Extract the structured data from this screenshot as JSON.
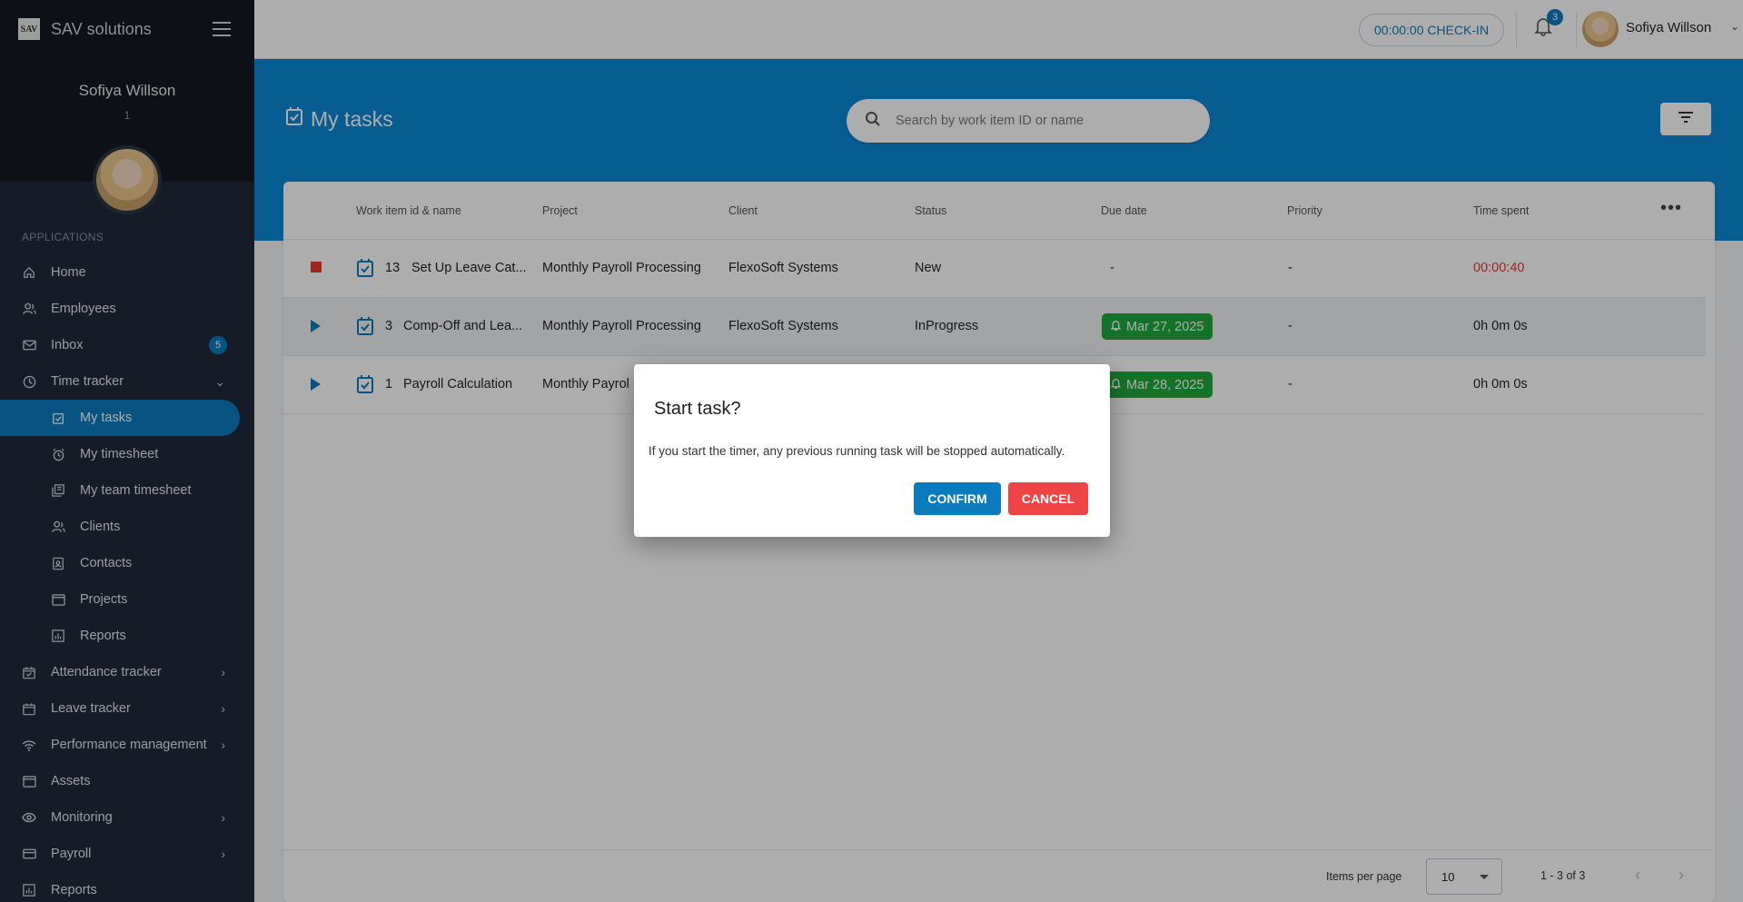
{
  "brand": {
    "logo_text": "SAV",
    "name": "SAV solutions"
  },
  "sidebar": {
    "user_name": "Sofiya Willson",
    "user_id": "1",
    "apps_label": "APPLICATIONS",
    "items": [
      {
        "label": "Home",
        "icon": "home-icon"
      },
      {
        "label": "Employees",
        "icon": "people-icon"
      },
      {
        "label": "Inbox",
        "icon": "mail-icon",
        "badge": "5"
      },
      {
        "label": "Time tracker",
        "icon": "clock-icon",
        "expanded": true
      },
      {
        "label": "My tasks",
        "icon": "task-check-icon",
        "active": true
      },
      {
        "label": "My timesheet",
        "icon": "alarm-icon"
      },
      {
        "label": "My team timesheet",
        "icon": "library-icon"
      },
      {
        "label": "Clients",
        "icon": "people-icon"
      },
      {
        "label": "Contacts",
        "icon": "contact-card-icon"
      },
      {
        "label": "Projects",
        "icon": "window-icon"
      },
      {
        "label": "Reports",
        "icon": "chart-icon"
      },
      {
        "label": "Attendance tracker",
        "icon": "calendar-check-icon"
      },
      {
        "label": "Leave tracker",
        "icon": "calendar-icon"
      },
      {
        "label": "Performance management",
        "icon": "wifi-icon"
      },
      {
        "label": "Assets",
        "icon": "window-icon"
      },
      {
        "label": "Monitoring",
        "icon": "eye-icon"
      },
      {
        "label": "Payroll",
        "icon": "card-icon"
      },
      {
        "label": "Reports",
        "icon": "chart-icon"
      }
    ]
  },
  "header": {
    "checkin_label": "00:00:00 CHECK-IN",
    "notification_count": "3",
    "user_name": "Sofiya Willson"
  },
  "page": {
    "title": "My tasks",
    "search_placeholder": "Search by work item ID or name"
  },
  "table": {
    "columns": [
      "Work item id & name",
      "Project",
      "Client",
      "Status",
      "Due date",
      "Priority",
      "Time spent"
    ],
    "rows": [
      {
        "id": "13",
        "name": "Set Up Leave Cat...",
        "project": "Monthly Payroll Processing",
        "client": "FlexoSoft Systems",
        "status": "New",
        "due": "-",
        "priority": "-",
        "time": "00:00:40",
        "running": true
      },
      {
        "id": "3",
        "name": "Comp-Off and Lea...",
        "project": "Monthly Payroll Processing",
        "client": "FlexoSoft Systems",
        "status": "InProgress",
        "due": "Mar 27, 2025",
        "priority": "-",
        "time": "0h 0m 0s",
        "running": false
      },
      {
        "id": "1",
        "name": "Payroll Calculation",
        "project": "Monthly Payrol",
        "client": "",
        "status": "",
        "due": "Mar 28, 2025",
        "priority": "-",
        "time": "0h 0m 0s",
        "running": false
      }
    ]
  },
  "pagination": {
    "items_per_page_label": "Items per page",
    "items_per_page": "10",
    "range": "1 - 3 of 3"
  },
  "modal": {
    "title": "Start task?",
    "message": "If you start the timer, any previous running task will be stopped automatically.",
    "confirm_label": "CONFIRM",
    "cancel_label": "CANCEL"
  },
  "colors": {
    "primary": "#0b7bbf",
    "hero": "#0b8ad6",
    "danger": "#ef4444",
    "success": "#1faa3d",
    "sidebar": "#1f2a3a"
  }
}
